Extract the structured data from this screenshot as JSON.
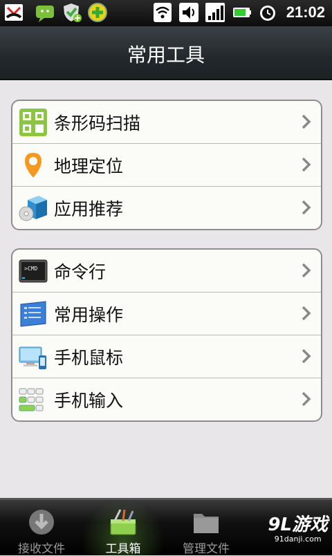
{
  "status_bar": {
    "time": "21:02",
    "icons": [
      "missed-call-icon",
      "sms-icon",
      "shield-check-icon",
      "plus-app-icon",
      "wifi-icon",
      "volume-icon",
      "signal-3g-icon",
      "battery-icon",
      "alarm-icon"
    ]
  },
  "header": {
    "title": "常用工具"
  },
  "groups": [
    {
      "items": [
        {
          "label": "条形码扫描",
          "icon": "barcode-scan-icon"
        },
        {
          "label": "地理定位",
          "icon": "location-pin-icon"
        },
        {
          "label": "应用推荐",
          "icon": "app-box-icon"
        }
      ]
    },
    {
      "items": [
        {
          "label": "命令行",
          "icon": "cmd-terminal-icon"
        },
        {
          "label": "常用操作",
          "icon": "operations-panel-icon"
        },
        {
          "label": "手机鼠标",
          "icon": "phone-mouse-icon"
        },
        {
          "label": "手机输入",
          "icon": "phone-keyboard-icon"
        }
      ]
    }
  ],
  "bottom_tabs": [
    {
      "label": "接收文件",
      "icon": "download-icon",
      "active": false
    },
    {
      "label": "工具箱",
      "icon": "toolbox-icon",
      "active": true
    },
    {
      "label": "管理文件",
      "icon": "folder-icon",
      "active": false
    }
  ],
  "watermark": {
    "brand": "9L游戏",
    "site": "91danji.com"
  }
}
